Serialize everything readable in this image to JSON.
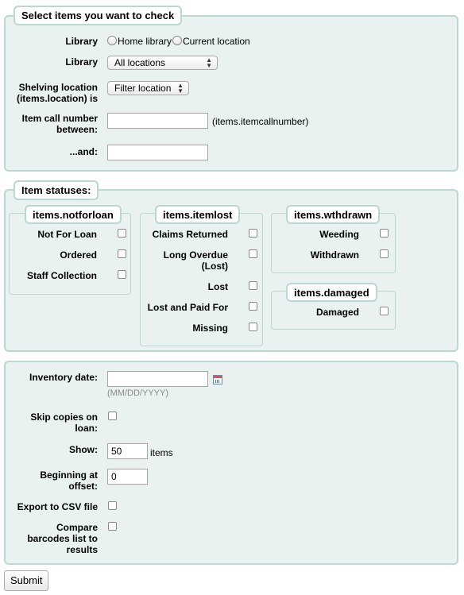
{
  "select_section": {
    "legend": "Select items you want to check",
    "library_radio_label": "Library",
    "radio_home": "Home library",
    "radio_current": "Current location",
    "library_select_label": "Library",
    "library_select_value": "All locations",
    "shelving_label": "Shelving location (items.location) is",
    "shelving_select_value": "Filter location",
    "callnumber_label": "Item call number between:",
    "callnumber_hint": "(items.itemcallnumber)",
    "and_label": "...and:"
  },
  "statuses_section": {
    "legend": "Item statuses:",
    "notforloan": {
      "legend": "items.notforloan",
      "items": [
        "Not For Loan",
        "Ordered",
        "Staff Collection"
      ]
    },
    "itemlost": {
      "legend": "items.itemlost",
      "items": [
        "Claims Returned",
        "Long Overdue (Lost)",
        "Lost",
        "Lost and Paid For",
        "Missing"
      ]
    },
    "wthdrawn": {
      "legend": "items.wthdrawn",
      "items": [
        "Weeding",
        "Withdrawn"
      ]
    },
    "damaged": {
      "legend": "items.damaged",
      "items": [
        "Damaged"
      ]
    }
  },
  "options_section": {
    "inventory_date_label": "Inventory date:",
    "date_hint": "(MM/DD/YYYY)",
    "skip_label": "Skip copies on loan:",
    "show_label": "Show:",
    "show_value": "50",
    "show_suffix": "items",
    "offset_label": "Beginning at offset:",
    "offset_value": "0",
    "export_label": "Export to CSV file",
    "compare_label": "Compare barcodes list to results"
  },
  "submit_label": "Submit"
}
